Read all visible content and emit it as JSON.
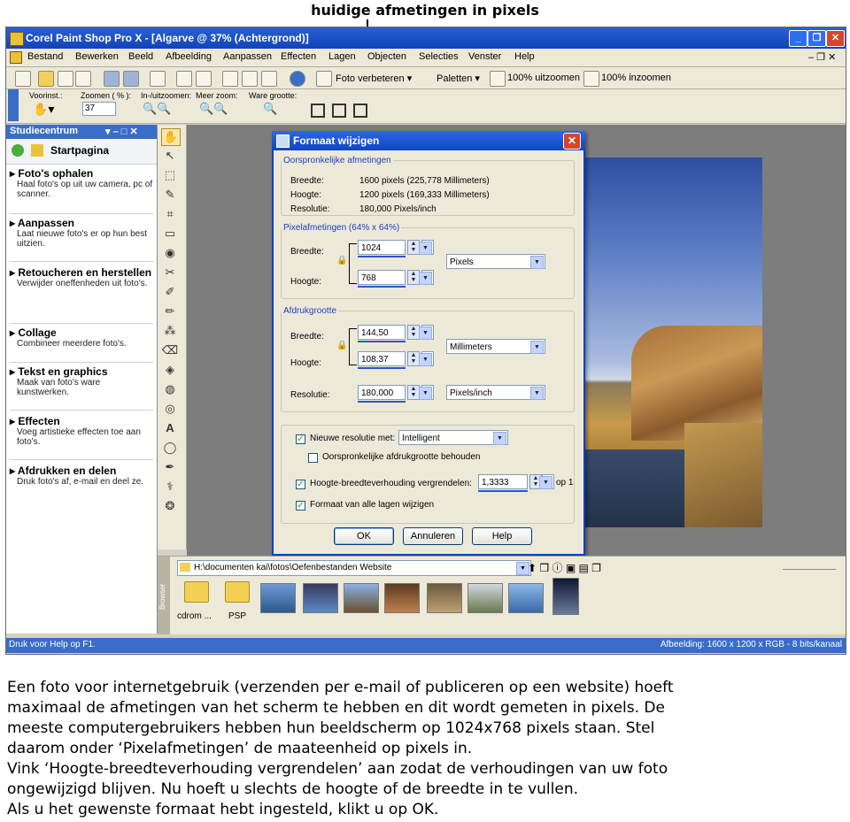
{
  "annotation": "huidige afmetingen in pixels",
  "window": {
    "title": "Corel Paint Shop Pro X - [Algarve @  37% (Achtergrond)]"
  },
  "menu": [
    "Bestand",
    "Bewerken",
    "Beeld",
    "Afbeelding",
    "Aanpassen",
    "Effecten",
    "Lagen",
    "Objecten",
    "Selecties",
    "Venster",
    "Help"
  ],
  "toolbar": {
    "foto_verbeteren": "Foto verbeteren",
    "paletten": "Paletten",
    "uitzoomen": "100% uitzoomen",
    "inzoomen": "100% inzoomen"
  },
  "toolbar2": {
    "voorinst": "Voorinst.:",
    "zoomen": "Zoomen ( % ):",
    "zoom_value": "37",
    "inuitzoomen": "In-/uitzoomen:",
    "meer_zoom": "Meer zoom:",
    "ware_grootte": "Ware grootte:"
  },
  "studio": {
    "header": "Studiecentrum",
    "home": "Startpagina",
    "tasks": [
      {
        "title": "Foto's ophalen",
        "desc": "Haal foto's op uit uw camera, pc of scanner."
      },
      {
        "title": "Aanpassen",
        "desc": "Laat nieuwe foto's er op hun best uitzien."
      },
      {
        "title": "Retoucheren en herstellen",
        "desc": "Verwijder oneffenheden uit foto's."
      },
      {
        "title": "Collage",
        "desc": "Combineer meerdere foto's."
      },
      {
        "title": "Tekst en graphics",
        "desc": "Maak van foto's ware kunstwerken."
      },
      {
        "title": "Effecten",
        "desc": "Voeg artistieke effecten toe aan foto's."
      },
      {
        "title": "Afdrukken en delen",
        "desc": "Druk foto's af, e-mail en deel ze."
      }
    ]
  },
  "dialog": {
    "title": "Formaat wijzigen",
    "original": {
      "legend": "Oorspronkelijke afmetingen",
      "breedte_label": "Breedte:",
      "breedte": "1600 pixels (225,778 Millimeters)",
      "hoogte_label": "Hoogte:",
      "hoogte": "1200 pixels (169,333 Millimeters)",
      "resolutie_label": "Resolutie:",
      "resolutie": "180,000 Pixels/inch"
    },
    "pixel": {
      "legend": "Pixelafmetingen (64% x 64%)",
      "breedte_label": "Breedte:",
      "breedte": "1024",
      "hoogte_label": "Hoogte:",
      "hoogte": "768",
      "unit": "Pixels"
    },
    "print": {
      "legend": "Afdrukgrootte",
      "breedte_label": "Breedte:",
      "breedte": "144,50",
      "hoogte_label": "Hoogte:",
      "hoogte": "108,37",
      "unit": "Millimeters",
      "resolutie_label": "Resolutie:",
      "resolutie": "180,000",
      "res_unit": "Pixels/inch"
    },
    "opts": {
      "nieuwe_resolutie": "Nieuwe resolutie met:",
      "methode": "Intelligent",
      "oorspronkelijke": "Oorspronkelijke afdrukgrootte behouden",
      "vergrendelen": "Hoogte-breedteverhouding vergrendelen:",
      "ratio": "1,3333",
      "op1": "op 1",
      "alle_lagen": "Formaat van alle lagen wijzigen"
    },
    "buttons": {
      "ok": "OK",
      "annuleren": "Annuleren",
      "help": "Help"
    }
  },
  "browser": {
    "path": "H:\\documenten kai\\fotos\\Oefenbestanden Website",
    "folders": [
      "cdrom ...",
      "PSP"
    ],
    "side_label": "Browser"
  },
  "status": {
    "left": "Druk voor Help op F1.",
    "right": "Afbeelding:  1600 x 1200 x RGB - 8 bits/kanaal"
  },
  "caption": [
    "Een foto voor internetgebruik (verzenden per e-mail of publiceren op een website) hoeft",
    "maximaal de afmetingen van het scherm te hebben en dit wordt gemeten in pixels. De",
    "meeste computergebruikers hebben hun beeldscherm op 1024x768 pixels staan. Stel",
    "daarom onder ‘Pixelafmetingen’ de maateenheid op pixels in.",
    "Vink ‘Hoogte-breedteverhouding vergrendelen’ aan zodat de verhoudingen van uw foto",
    "ongewijzigd blijven. Nu hoeft u slechts de hoogte of de breedte in te vullen.",
    "Als u het gewenste formaat hebt ingesteld, klikt u op OK."
  ]
}
